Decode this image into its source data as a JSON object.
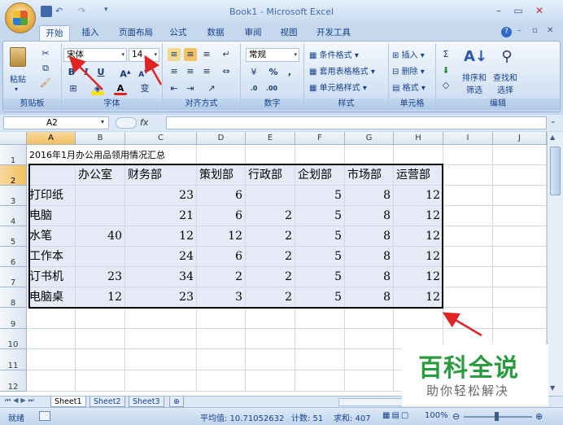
{
  "window": {
    "title": "Book1 - Microsoft Excel"
  },
  "ribbon_tabs": [
    "开始",
    "插入",
    "页面布局",
    "公式",
    "数据",
    "审阅",
    "视图",
    "开发工具"
  ],
  "ribbon": {
    "clipboard": {
      "paste": "粘贴",
      "label": "剪贴板"
    },
    "font": {
      "name": "宋体",
      "size": "14",
      "label": "字体"
    },
    "alignment": {
      "label": "对齐方式"
    },
    "number": {
      "format": "常规",
      "label": "数字"
    },
    "styles": {
      "conditional": "条件格式",
      "table": "套用表格格式",
      "cell": "单元格样式",
      "label": "样式"
    },
    "cells": {
      "insert": "插入",
      "delete": "删除",
      "format": "格式",
      "label": "单元格"
    },
    "editing": {
      "sort": "排序和\n筛选",
      "find": "查找和\n选择",
      "sort1": "排序和",
      "sort2": "筛选",
      "find1": "查找和",
      "find2": "选择",
      "label": "编辑"
    }
  },
  "formula_bar": {
    "name_box": "A2",
    "fx": "fx",
    "value": ""
  },
  "columns": [
    "A",
    "B",
    "C",
    "D",
    "E",
    "F",
    "G",
    "H",
    "I",
    "J"
  ],
  "rows": [
    "1",
    "2",
    "3",
    "4",
    "5",
    "6",
    "7",
    "8",
    "9",
    "10",
    "11",
    "12"
  ],
  "sheet": {
    "title": "2016年1月办公用品领用情况汇总",
    "headers": [
      "办公室",
      "财务部",
      "策划部",
      "行政部",
      "企划部",
      "市场部",
      "运营部"
    ],
    "data": [
      [
        "打印纸",
        "",
        "23",
        "6",
        "",
        "5",
        "8",
        "12"
      ],
      [
        "电脑",
        "",
        "21",
        "6",
        "2",
        "5",
        "8",
        "12"
      ],
      [
        "水笔",
        "40",
        "12",
        "12",
        "2",
        "5",
        "8",
        "12"
      ],
      [
        "工作本",
        "",
        "24",
        "6",
        "2",
        "5",
        "8",
        "12"
      ],
      [
        "订书机",
        "23",
        "34",
        "2",
        "2",
        "5",
        "8",
        "12"
      ],
      [
        "电脑桌",
        "12",
        "23",
        "3",
        "2",
        "5",
        "8",
        "12"
      ]
    ]
  },
  "sheet_tabs": [
    "Sheet1",
    "Sheet2",
    "Sheet3"
  ],
  "status": {
    "ready": "就绪",
    "average": "平均值: 10.71052632",
    "count": "计数: 51",
    "sum": "求和: 407",
    "zoom": "100%"
  },
  "watermark": {
    "main": "百科全说",
    "sub": "助你轻松解决"
  }
}
